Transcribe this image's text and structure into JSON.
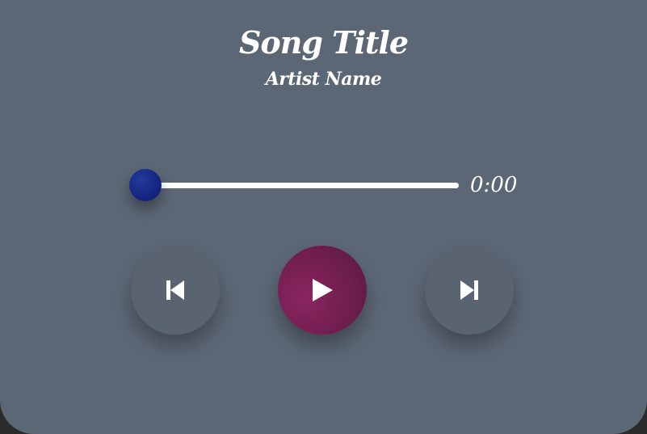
{
  "song": {
    "title": "Song Title",
    "artist": "Artist Name"
  },
  "progress": {
    "fraction": 0,
    "time_label": "0:00"
  },
  "controls": {
    "previous_icon": "skip-previous-icon",
    "play_icon": "play-icon",
    "next_icon": "skip-next-icon"
  },
  "colors": {
    "background": "#5c6775",
    "thumb": "#142680",
    "play_button": "#751f52",
    "side_button": "#5a6370",
    "text": "#ffffff"
  }
}
